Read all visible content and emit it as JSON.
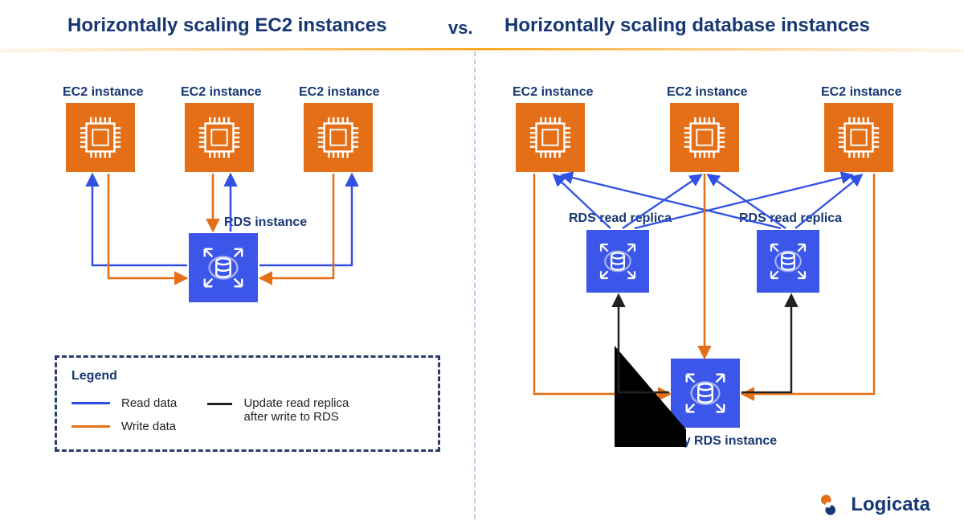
{
  "titles": {
    "left": "Horizontally scaling EC2 instances",
    "vs": "vs.",
    "right": "Horizontally scaling database instances"
  },
  "labels": {
    "ec2": "EC2 instance",
    "rds_instance": "RDS instance",
    "rds_replica": "RDS read replica",
    "rds_primary": "Primary RDS instance"
  },
  "legend": {
    "title": "Legend",
    "read": "Read data",
    "write": "Write data",
    "update": "Update read replica after write to RDS"
  },
  "brand": {
    "name": "Logicata"
  },
  "colors": {
    "read": "#3051e3",
    "write": "#e46f16",
    "update": "#222222"
  }
}
